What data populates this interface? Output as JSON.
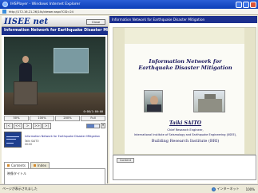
{
  "window": {
    "title": "IHSPlayer - Windows Internet Explorer",
    "url": "http://172.16.21.26/14s/viewer.aspx?CID=24"
  },
  "player": {
    "logo": "IISEE net",
    "close_label": "Close",
    "subtitle": "Information Network for Earthquake Disaster Mi",
    "timecode": "0:08/1:00:00",
    "zoom_options": [
      "50%",
      "100%",
      "200%",
      "Full"
    ],
    "controls": [
      "|<",
      "<<",
      ">",
      ">>",
      ">|"
    ],
    "volume_level": 0.6,
    "thumb_caption": "Information Network for Earthquake Disaster Mitigation",
    "thumb_sub": "Taiki SAITO",
    "thumb_time": "00:00"
  },
  "tabs": {
    "contents_label": "Contents",
    "index_label": "Index",
    "panel_label": "映像タイトル"
  },
  "slide": {
    "header": "Information Network for Earthquake Disaster Mitigation",
    "title_line1": "Information Network for",
    "title_line2": "Earthquake Disaster Mitigation",
    "author": "Taiki SAITO",
    "role": "Chief Research Engineer,",
    "affiliation": "International Institute of Seismology and Earthquake Engineering (IISEE),",
    "institute": "Building Research Institute (BRI)"
  },
  "contents_panel": {
    "button_label": "Content"
  },
  "status": {
    "text": "ページが表示されました",
    "zone": "インターネット",
    "zoom": "100%"
  }
}
